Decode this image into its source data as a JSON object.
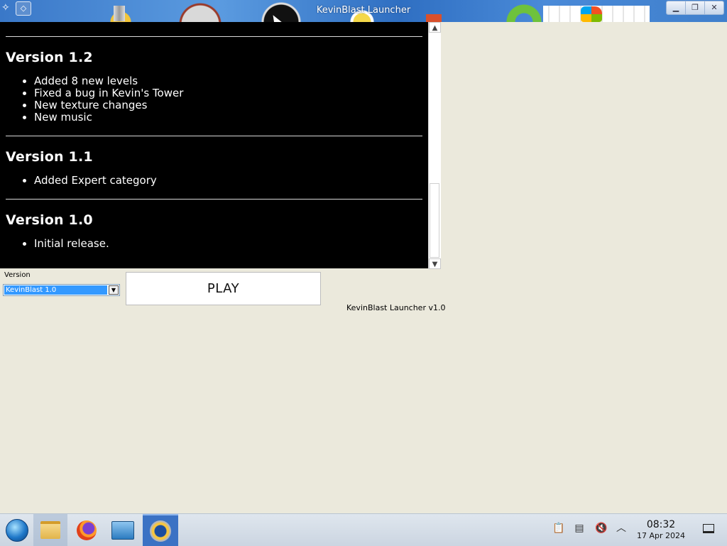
{
  "window": {
    "title": "KevinBlast Launcher",
    "controls": {
      "minimize": "▁",
      "maximize": "❐",
      "close": "✕"
    }
  },
  "changelog": {
    "versions": [
      {
        "title": "Version 1.2",
        "items": [
          "Added 8 new levels",
          "Fixed a bug in Kevin's Tower",
          "New texture changes",
          "New music"
        ]
      },
      {
        "title": "Version 1.1",
        "items": [
          "Added Expert category"
        ]
      },
      {
        "title": "Version 1.0",
        "items": [
          "Initial release."
        ]
      }
    ],
    "colors": {
      "background": "#000000",
      "text": "#ffffff"
    }
  },
  "controls": {
    "version_label": "Version",
    "version_selected": "KevinBlast 1.0",
    "play_label": "PLAY",
    "launcher_version": "KevinBlast Launcher v1.0"
  },
  "taskbar": {
    "apps": [
      "start-orb",
      "file-manager-icon",
      "firefox-icon",
      "system-settings-icon",
      "kevinblast-icon"
    ],
    "tray_icons": [
      "clipboard-icon",
      "battery-icon",
      "volume-muted-icon",
      "tray-expand-icon"
    ],
    "clock_time": "08:32",
    "clock_date": "17 Apr 2024"
  }
}
